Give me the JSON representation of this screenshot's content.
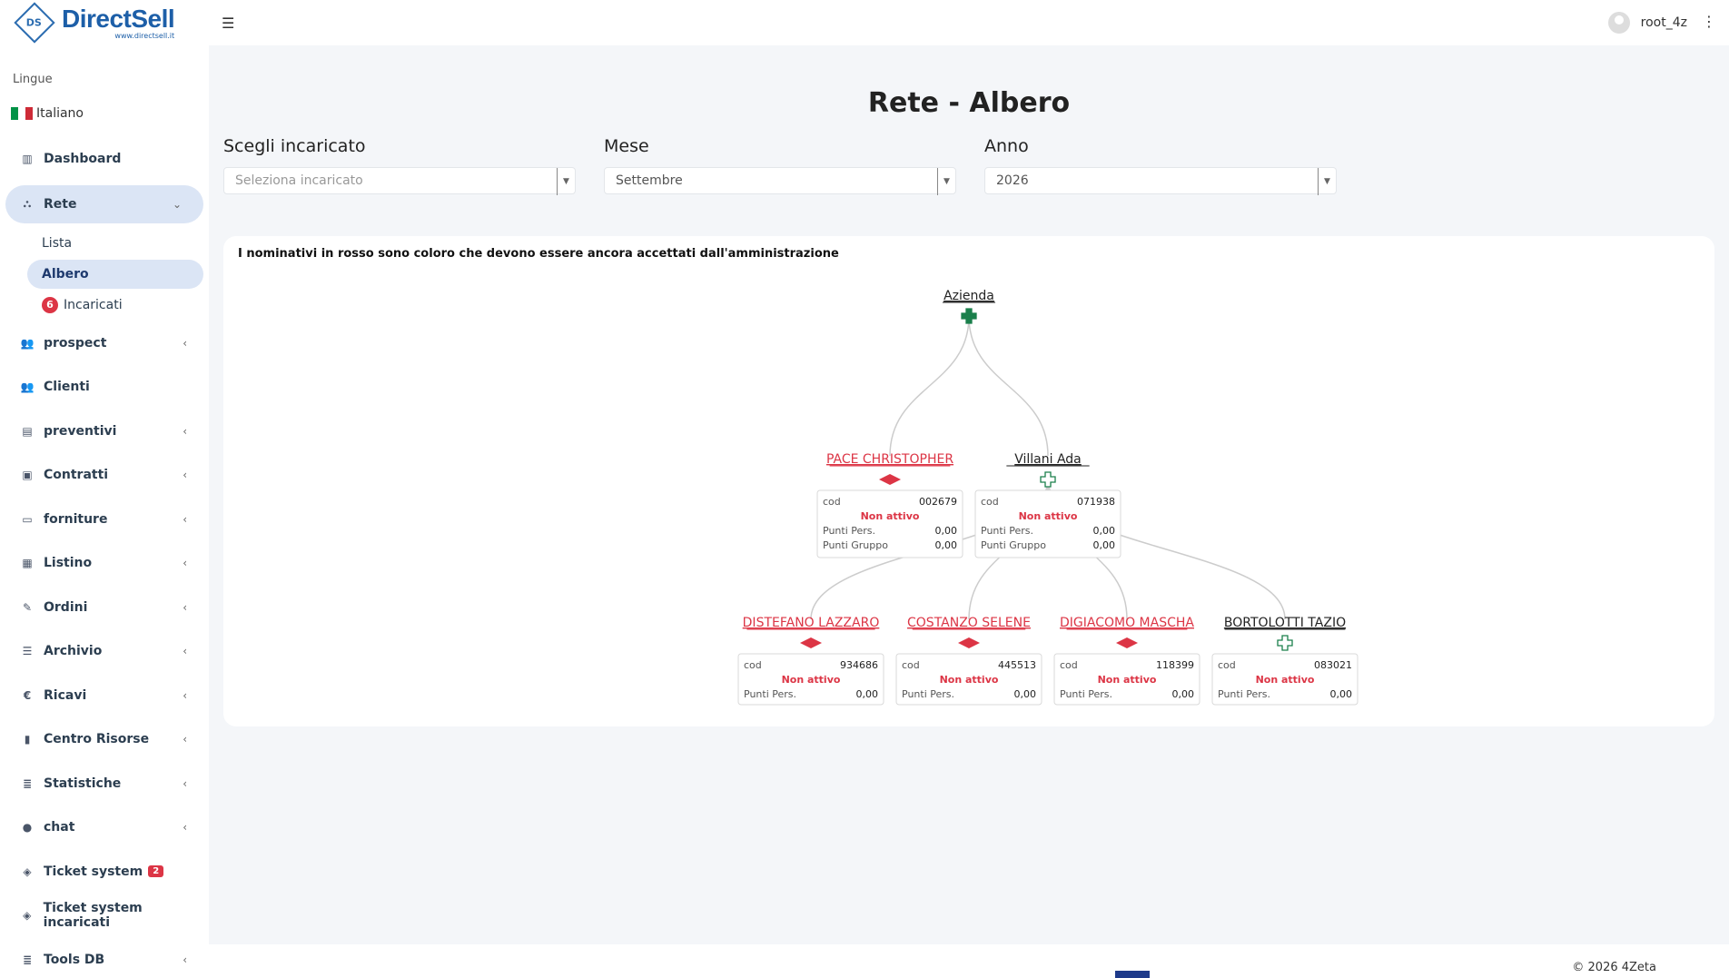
{
  "app": {
    "logo_title": "DirectSell",
    "logo_url_text": "www.directsell.it",
    "logo_mark": "DS"
  },
  "sidebar": {
    "lang_label": "Lingue",
    "lang_value": "Italiano",
    "items": [
      {
        "label": "Dashboard",
        "icon": "bar-chart-icon"
      },
      {
        "label": "Rete",
        "icon": "sitemap-icon"
      },
      {
        "label": "prospect",
        "icon": "users-icon"
      },
      {
        "label": "Clienti",
        "icon": "users-icon"
      },
      {
        "label": "preventivi",
        "icon": "file-icon"
      },
      {
        "label": "Contratti",
        "icon": "briefcase-icon"
      },
      {
        "label": "forniture",
        "icon": "credit-card-icon"
      },
      {
        "label": "Listino",
        "icon": "list-alt-icon"
      },
      {
        "label": "Ordini",
        "icon": "edit-icon"
      },
      {
        "label": "Archivio",
        "icon": "list-icon"
      },
      {
        "label": "Ricavi",
        "icon": "euro-icon"
      },
      {
        "label": "Centro Risorse",
        "icon": "book-icon"
      },
      {
        "label": "Statistiche",
        "icon": "database-icon"
      },
      {
        "label": "chat",
        "icon": "comments-icon"
      },
      {
        "label": "Ticket system",
        "icon": "ticket-icon",
        "badge": "2"
      },
      {
        "label": "Ticket system incaricati",
        "icon": "ticket-icon"
      },
      {
        "label": "Tools DB",
        "icon": "database-icon"
      }
    ],
    "sub_items": [
      {
        "label": "Lista"
      },
      {
        "label": "Albero"
      },
      {
        "label": "Incaricati",
        "badge": "6"
      }
    ]
  },
  "topbar": {
    "username": "root_4z"
  },
  "main": {
    "title": "Rete - Albero",
    "filters": {
      "incaricato": {
        "label": "Scegli incaricato",
        "placeholder": "Seleziona incaricato"
      },
      "mese": {
        "label": "Mese",
        "value": "Settembre"
      },
      "anno": {
        "label": "Anno",
        "value": "2026"
      }
    },
    "note": "I nominativi in rosso sono coloro che devono essere ancora accettati dall'amministrazione"
  },
  "tree": {
    "cod_label": "cod",
    "punti_pers_label": "Punti Pers.",
    "punti_gruppo_label": "Punti Gruppo",
    "root": {
      "name": "Azienda"
    },
    "level1": [
      {
        "name": "PACE CHRISTOPHER",
        "cod": "002679",
        "status": "Non attivo",
        "punti_pers": "0,00",
        "punti_gruppo": "0,00",
        "pending": true
      },
      {
        "name": "Villani Ada",
        "cod": "071938",
        "status": "Non attivo",
        "punti_pers": "0,00",
        "punti_gruppo": "0,00",
        "pending": false
      }
    ],
    "level2": [
      {
        "name": "DISTEFANO LAZZARO",
        "cod": "934686",
        "status": "Non attivo",
        "punti_pers": "0,00",
        "pending": true
      },
      {
        "name": "COSTANZO SELENE",
        "cod": "445513",
        "status": "Non attivo",
        "punti_pers": "0,00",
        "pending": true
      },
      {
        "name": "DIGIACOMO MASCHA",
        "cod": "118399",
        "status": "Non attivo",
        "punti_pers": "0,00",
        "pending": true
      },
      {
        "name": "BORTOLOTTI TAZIO",
        "cod": "083021",
        "status": "Non attivo",
        "punti_pers": "0,00",
        "pending": true
      }
    ],
    "colors": {
      "pending": "#dc3545",
      "normal": "#222222",
      "plus": "#1a7f4b",
      "link": "#cccccc"
    }
  },
  "footer": {
    "copyright": "© 2026 4Zeta"
  }
}
